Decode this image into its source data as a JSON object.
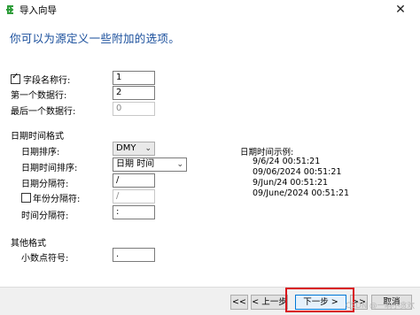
{
  "window": {
    "title": "导入向导",
    "close_glyph": "✕"
  },
  "heading": "你可以为源定义一些附加的选项。",
  "fields": {
    "field_name_row": {
      "label": "字段名称行:",
      "value": "1",
      "checked": true
    },
    "first_data_row": {
      "label": "第一个数据行:",
      "value": "2"
    },
    "last_data_row": {
      "label": "最后一个数据行:",
      "placeholder": "0"
    }
  },
  "datetime": {
    "section_label": "日期时间格式",
    "date_order_label": "日期排序:",
    "date_order_value": "DMY",
    "datetime_order_label": "日期时间排序:",
    "datetime_order_value": "日期 时间",
    "date_sep_label": "日期分隔符:",
    "date_sep_value": "/",
    "year_sep_label": "年份分隔符:",
    "year_sep_value": "/",
    "year_sep_checked": false,
    "time_sep_label": "时间分隔符:",
    "time_sep_value": ":"
  },
  "preview": {
    "label": "日期时间示例:",
    "lines": [
      "9/6/24 00:51:21",
      "09/06/2024 00:51:21",
      "9/Jun/24 00:51:21",
      "09/June/2024 00:51:21"
    ]
  },
  "other": {
    "section_label": "其他格式",
    "decimal_label": "小数点符号:",
    "decimal_value": "."
  },
  "footer": {
    "first_btn": "<<",
    "back_btn": "< 上一步",
    "next_btn": "下一步 >",
    "last_btn": ">>",
    "cancel_btn": "取消"
  },
  "watermark": "CSDN @一晌小贪欢",
  "colors": {
    "heading": "#1a4f9c",
    "highlight": "#d9121a"
  }
}
